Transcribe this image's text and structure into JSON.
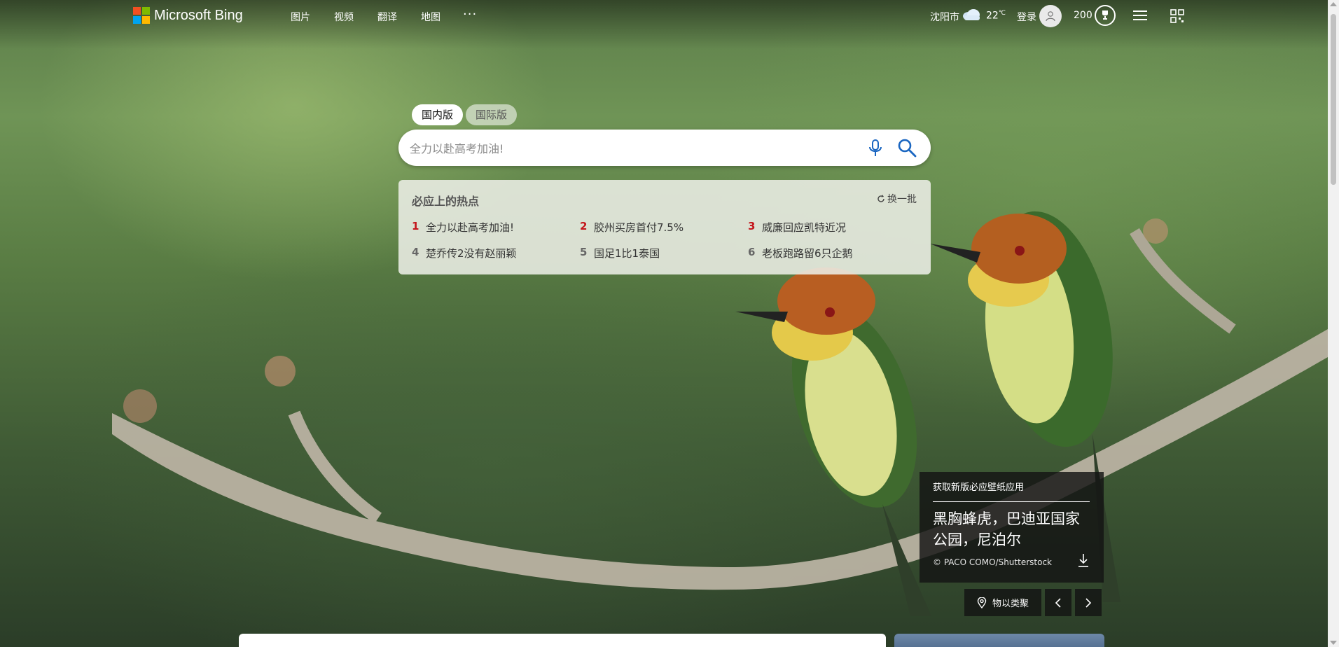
{
  "header": {
    "logo_text": "Microsoft Bing",
    "nav": [
      "图片",
      "视频",
      "翻译",
      "地图"
    ],
    "more": "···",
    "city": "沈阳市",
    "temperature": "22",
    "temp_unit": "℃",
    "login": "登录",
    "points": "200"
  },
  "search": {
    "tabs": [
      "国内版",
      "国际版"
    ],
    "placeholder": "全力以赴高考加油!"
  },
  "hot": {
    "title": "必应上的热点",
    "refresh": "换一批",
    "items": [
      {
        "num": "1",
        "text": "全力以赴高考加油!"
      },
      {
        "num": "2",
        "text": "胶州买房首付7.5%"
      },
      {
        "num": "3",
        "text": "威廉回应凯特近况"
      },
      {
        "num": "4",
        "text": "楚乔传2没有赵丽颖"
      },
      {
        "num": "5",
        "text": "国足1比1泰国"
      },
      {
        "num": "6",
        "text": "老板跑路留6只企鹅"
      }
    ]
  },
  "image_info": {
    "promo": "获取新版必应壁纸应用",
    "title": "黑胸蜂虎，巴迪亚国家公园，尼泊尔",
    "copyright": "© PACO COMO/Shutterstock",
    "location_label": "物以类聚"
  },
  "colors": {
    "ms_red": "#f25022",
    "ms_green": "#7fba00",
    "ms_blue": "#00a4ef",
    "ms_yellow": "#ffb900",
    "hot_rank_red": "#c4161c",
    "search_icon_blue": "#1a66c1"
  },
  "icons": {
    "weather": "cloud-icon",
    "avatar": "user-icon",
    "rewards": "trophy-icon",
    "menu": "hamburger-icon",
    "qr": "qr-code-icon",
    "mic": "microphone-icon",
    "search": "search-icon",
    "refresh": "refresh-icon",
    "download": "download-icon",
    "location": "location-pin-icon",
    "prev": "chevron-left-icon",
    "next": "chevron-right-icon"
  }
}
